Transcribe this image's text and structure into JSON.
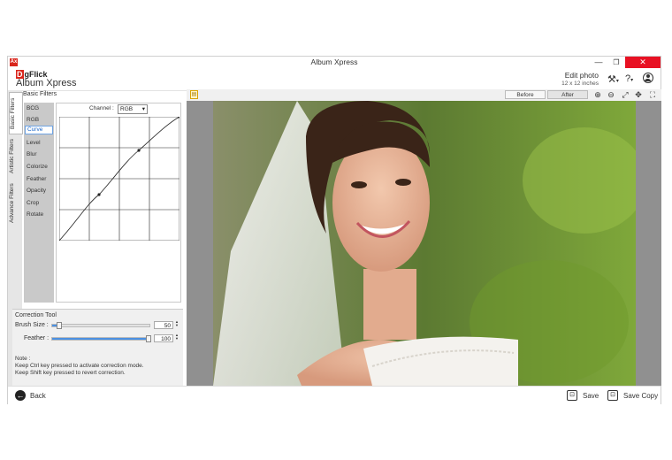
{
  "window": {
    "title": "Album Xpress",
    "app_icon": "Ax",
    "controls": {
      "minimize": "—",
      "restore": "❐",
      "close": "✕"
    }
  },
  "header": {
    "brand_mark_d": "D",
    "brand_mark_rest": "gFlick",
    "brand_name": "Album Xpress",
    "edit_title": "Edit photo",
    "edit_size": "12 x 12 inches",
    "icons": [
      "tools-icon",
      "help-icon",
      "user-icon"
    ]
  },
  "side_tabs": [
    "Basic Filters",
    "Artistic Filters",
    "Advance Filters"
  ],
  "basic_filters": {
    "title": "Basic Filters",
    "items": [
      "BCG",
      "RGB",
      "Curve",
      "Level",
      "Blur",
      "Colorize",
      "Feather",
      "Opacity",
      "Crop",
      "Rotate"
    ],
    "selected": "Curve"
  },
  "curve": {
    "channel_label": "Channel :",
    "channel_value": "RGB",
    "points": [
      [
        0,
        0
      ],
      [
        0.28,
        0.35
      ],
      [
        0.53,
        0.65
      ],
      [
        1,
        1
      ]
    ]
  },
  "correction": {
    "title": "Correction Tool",
    "brush_label": "Brush Size :",
    "brush_value": "50",
    "brush_level": 0.05,
    "feather_label": "Feather :",
    "feather_value": "100",
    "feather_level": 1.0,
    "note_title": "Note :",
    "note_line1": "Keep Ctrl key pressed to activate correction mode.",
    "note_line2": "Keep Shift key pressed to revert correction."
  },
  "viewer": {
    "before_label": "Before",
    "after_label": "After",
    "tools": [
      "zoom-in-icon",
      "zoom-out-icon",
      "fit-icon",
      "pan-icon",
      "fullscreen-icon"
    ]
  },
  "footer": {
    "back_label": "Back",
    "save_label": "Save",
    "save_copy_label": "Save Copy"
  },
  "colors": {
    "accent": "#4a90e2",
    "brand_red": "#d9261c",
    "close_red": "#e81123"
  }
}
